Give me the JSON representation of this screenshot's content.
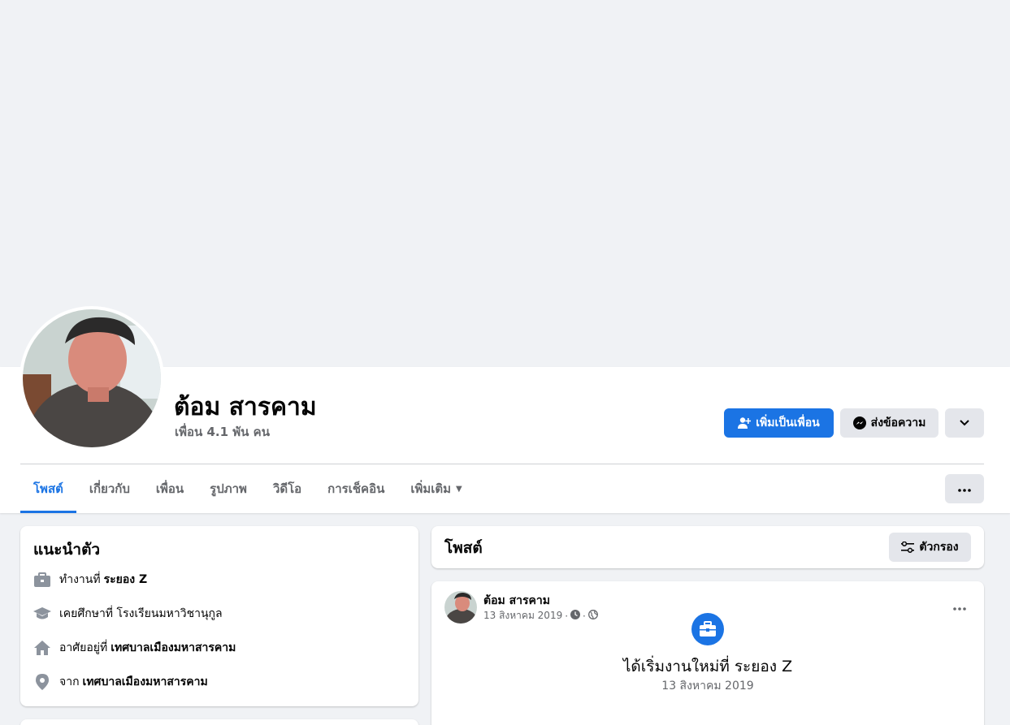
{
  "profile": {
    "name": "ต้อม สารคาม",
    "friends_count": "เพื่อน 4.1 พัน คน"
  },
  "actions": {
    "add_friend_label": "เพิ่มเป็นเพื่อน",
    "message_label": "ส่งข้อความ",
    "more_icon": "chevron-down-icon"
  },
  "tabs": [
    {
      "label": "โพสต์",
      "active": true
    },
    {
      "label": "เกี่ยวกับ",
      "active": false
    },
    {
      "label": "เพื่อน",
      "active": false
    },
    {
      "label": "รูปภาพ",
      "active": false
    },
    {
      "label": "วิดีโอ",
      "active": false
    },
    {
      "label": "การเช็คอิน",
      "active": false
    },
    {
      "label": "เพิ่มเติม",
      "active": false
    }
  ],
  "intro": {
    "title": "แนะนำตัว",
    "items": [
      {
        "icon": "briefcase-icon",
        "prefix": "ทำงานที่",
        "value": "ระยอง Z"
      },
      {
        "icon": "graduation-cap-icon",
        "prefix": "เคยศึกษาที่ โรงเรียนมหาวิชานุกูล",
        "value": ""
      },
      {
        "icon": "home-icon",
        "prefix": "อาศัยอยู่ที่",
        "value": "เทศบาลเมืองมหาสารคาม"
      },
      {
        "icon": "location-pin-icon",
        "prefix": "จาก",
        "value": "เทศบาลเมืองมหาสารคาม"
      }
    ]
  },
  "posts_header": {
    "title": "โพสต์",
    "filter_label": "ตัวกรอง"
  },
  "post": {
    "author": "ต้อม สารคาม",
    "date": "13 สิงหาคม 2019",
    "life_event_title": "ได้เริ่มงานใหม่ที่ ระยอง Z",
    "life_event_date": "13 สิงหาคม 2019"
  },
  "colors": {
    "accent": "#1b74e4",
    "background": "#f0f2f5",
    "secondary_text": "#65676b"
  }
}
